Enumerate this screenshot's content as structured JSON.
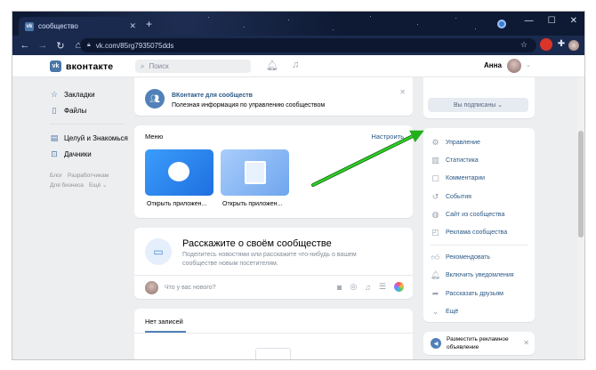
{
  "browser": {
    "tab_title": "сообщество",
    "tab_icon": "vk-logo-icon",
    "url": "vk.com/85rg7935075dds",
    "window_controls": [
      "—",
      "☐",
      "✕"
    ]
  },
  "vk_header": {
    "logo_text": "вконтакте",
    "search_placeholder": "Поиск",
    "user_name": "Анна"
  },
  "left_menu": {
    "items": [
      {
        "label": "Закладки",
        "icon": "star-icon"
      },
      {
        "label": "Файлы",
        "icon": "file-icon"
      }
    ],
    "items2": [
      {
        "label": "Целуй и Знакомься",
        "icon": "grid-icon"
      },
      {
        "label": "Дачники",
        "icon": "gamepad-icon"
      }
    ],
    "footer_links": [
      "Блог",
      "Разработчикам",
      "Для бизнеса",
      "Ещё ⌄"
    ]
  },
  "banner": {
    "title": "ВКонтакте для сообществ",
    "text": "Полезная информация по управлению сообществом"
  },
  "apps_menu": {
    "title": "Меню",
    "configure": "Настроить",
    "apps": [
      "Открыть приложен...",
      "Открыть приложен..."
    ]
  },
  "post_prompt": {
    "title": "Расскажите о своём сообществе",
    "desc": "Поделитесь новостями или расскажите что-нибудь о вашем сообществе новым посетителям.",
    "placeholder": "Что у вас нового?"
  },
  "wall": {
    "tab": "Нет записей"
  },
  "right_top": {
    "subscribed_button": "Вы подписаны ⌄"
  },
  "right_menu": {
    "group1": [
      {
        "label": "Управление",
        "icon": "gear-icon"
      },
      {
        "label": "Статистика",
        "icon": "chart-icon"
      },
      {
        "label": "Комментарии",
        "icon": "comment-icon"
      },
      {
        "label": "События",
        "icon": "event-icon"
      },
      {
        "label": "Сайт из сообщества",
        "icon": "globe-icon"
      },
      {
        "label": "Реклама сообщества",
        "icon": "ads-icon"
      }
    ],
    "group2": [
      {
        "label": "Рекомендовать",
        "icon": "like-icon"
      },
      {
        "label": "Включить уведомления",
        "icon": "bell-icon"
      },
      {
        "label": "Рассказать друзьям",
        "icon": "share-icon"
      },
      {
        "label": "Ещё",
        "icon": "chevron-down-icon"
      }
    ]
  },
  "ad_block": {
    "text": "Разместить рекламное объявление"
  },
  "colors": {
    "vk_blue": "#4a76a8",
    "link": "#2a5885",
    "arrow": "#22b01c"
  }
}
